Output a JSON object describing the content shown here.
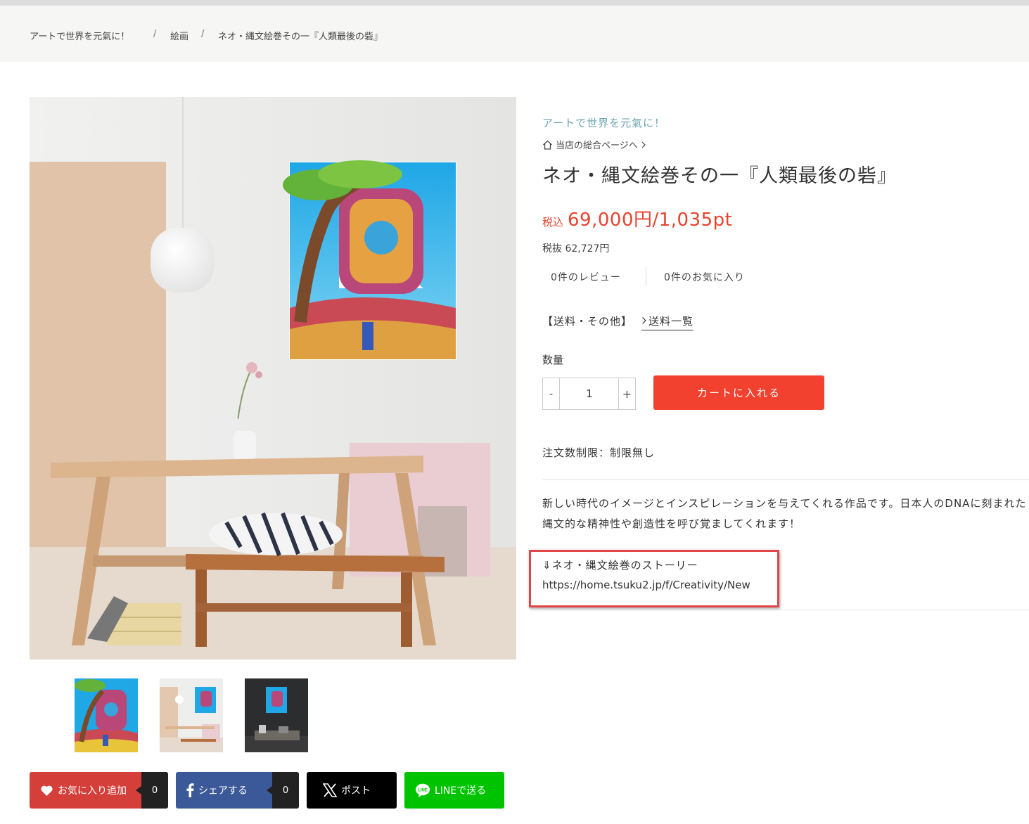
{
  "breadcrumb": {
    "items": [
      "アートで世界を元氣に！",
      "絵画",
      "ネオ・縄文絵巻その一『人類最後の砦』"
    ],
    "separator": "/"
  },
  "product": {
    "shop_name": "アートで世界を元氣に！",
    "shop_link": "当店の総合ページへ",
    "title": "ネオ・縄文絵巻その一『人類最後の砦』",
    "price_tax_label": "税込",
    "price": "69,000円/1,035pt",
    "price_ex_tax": "税抜 62,727円",
    "reviews": "0件のレビュー",
    "favorites": "0件のお気に入り",
    "shipping_label": "【送料・その他】",
    "shipping_link": "送料一覧",
    "quantity_label": "数量",
    "quantity_minus": "-",
    "quantity_value": "1",
    "quantity_plus": "+",
    "cart_button": "カートに入れる",
    "order_limit": "注文数制限：制限無し",
    "description": "新しい時代のイメージとインスピレーションを与えてくれる作品です。日本人のDNAに刻まれた縄文的な精神性や創造性を呼び覚ましてくれます！",
    "story_line1": "⇓ネオ・縄文絵巻のストーリー",
    "story_line2": "https://home.tsuku2.jp/f/Creativity/New"
  },
  "share": {
    "favorite_label": "お気に入り追加",
    "favorite_count": "0",
    "facebook_label": "シェアする",
    "facebook_count": "0",
    "x_label": "ポスト",
    "line_label": "LINEで送る"
  },
  "colors": {
    "price": "#e8432e",
    "cart": "#f3412f",
    "shop_name": "#6aa5b0",
    "favorite_btn": "#d43f3a",
    "facebook_btn": "#3b5998",
    "x_btn": "#000000",
    "line_btn": "#00c300",
    "highlight_box": "#e04548"
  }
}
